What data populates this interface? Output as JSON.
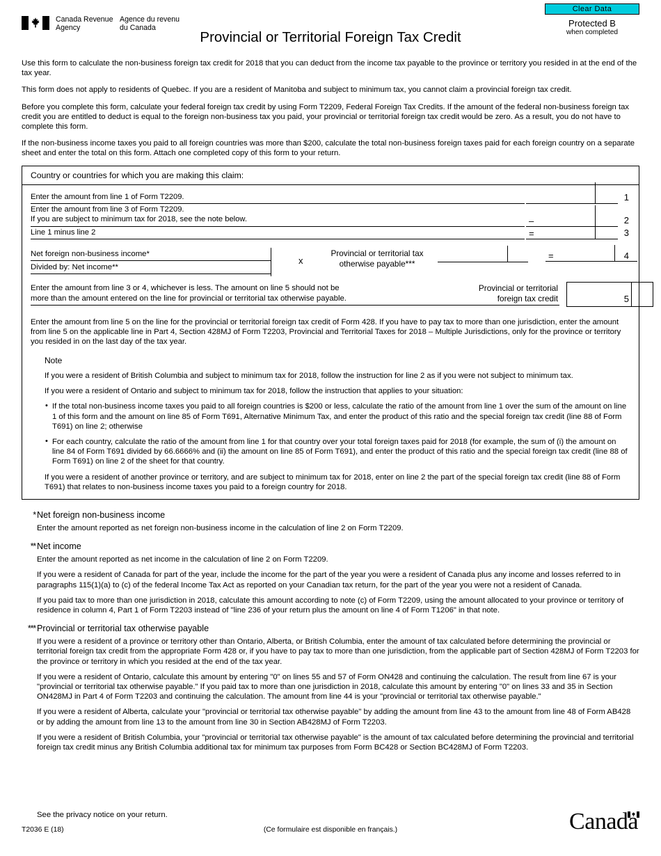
{
  "header": {
    "clear_data_label": "Clear Data",
    "protected_line1": "Protected B",
    "protected_line2": "when completed",
    "agency_en_line1": "Canada Revenue",
    "agency_en_line2": "Agency",
    "agency_fr_line1": "Agence du revenu",
    "agency_fr_line2": "du Canada",
    "title": "Provincial or Territorial Foreign Tax Credit",
    "flag_icon": "canada-flag-icon"
  },
  "intro": {
    "p1": "Use this form to calculate the non-business foreign tax credit for 2018 that you can deduct from the income tax payable to the province or territory you resided in at the end of the tax year.",
    "p2": "This form does not apply to residents of Quebec. If you are a resident of Manitoba and subject to minimum tax, you cannot claim a provincial foreign tax credit.",
    "p3": "Before you complete this form, calculate your federal foreign tax credit by using Form T2209, Federal Foreign Tax Credits. If the amount of the federal non-business foreign tax credit you are entitled to deduct is equal to the foreign non-business tax you paid, your provincial or territorial foreign tax credit would be zero. As a result, you do not have to complete this form.",
    "p4": "If the non-business income taxes you paid to all foreign countries was more than $200, calculate the total non-business foreign taxes paid for each foreign country on a separate sheet and enter the total on this form. Attach one completed copy of this form to your return."
  },
  "form": {
    "country_label": "Country or countries for which you are making this claim:",
    "country_value": "",
    "line1": {
      "label": "Enter the amount from line 1 of Form T2209.",
      "number": "1",
      "operator": "",
      "value": ""
    },
    "line2": {
      "label_a": "Enter the amount from line 3 of Form T2209.",
      "label_b_pre": "If you are subject to minimum tax for 2018, see the ",
      "label_b_link": "note",
      "label_b_post": " below.",
      "number": "2",
      "operator": "–",
      "value": ""
    },
    "line3": {
      "label": "Line 1 minus line 2",
      "number": "3",
      "operator": "=",
      "value": ""
    },
    "line4": {
      "numerator_label": "Net foreign non-business income",
      "numerator_mark": "*",
      "denominator_label": "Divided by: Net income",
      "denominator_mark": "**",
      "times_symbol": "x",
      "multiplier_label_line1": "Provincial or territorial tax",
      "multiplier_label_line2": "otherwise payable",
      "multiplier_mark": "***",
      "number": "4",
      "operator": "=",
      "numerator_value": "",
      "denominator_value": "",
      "multiplier_value": "",
      "value": ""
    },
    "line5": {
      "desc_line1": "Enter the amount from line 3 or 4, whichever is less. The amount on line 5 should not be",
      "desc_line2": "more than the amount entered on the line for provincial or territorial tax otherwise payable.",
      "credit_label_line1": "Provincial or territorial",
      "credit_label_line2": "foreign tax credit",
      "number": "5",
      "value": ""
    },
    "bottom_instruction": "Enter the amount from line 5 on the line for the provincial or territorial foreign tax credit of Form 428. If you have to pay tax to more than one jurisdiction, enter the amount from line 5 on the applicable line in Part 4, Section 428MJ of Form T2203, Provincial and Territorial Taxes for 2018 – Multiple Jurisdictions, only for the province or territory you resided in on the last day of the tax year.",
    "note": {
      "title": "Note",
      "p1": "If you were a resident of British Columbia and subject to minimum tax for 2018, follow the instruction for line 2 as if you were not subject to minimum tax.",
      "p2": "If you were a resident of Ontario and subject to minimum tax for 2018, follow the instruction that applies to your situation:",
      "bullet1": "If the total non-business income taxes you paid to all foreign countries is $200 or less, calculate the ratio of the amount from line 1 over the sum of the amount on line 1 of this form and the amount on line 85 of Form T691, Alternative Minimum Tax, and enter the product of this ratio and the special foreign tax credit (line 88 of Form T691) on line 2; otherwise",
      "bullet2": "For each country, calculate the ratio of the amount from line 1 for that country over your total foreign taxes paid for 2018 (for example, the sum of (i) the amount on line 84 of Form T691 divided by 66.6666% and (ii) the amount on line 85 of Form T691), and enter the product of this ratio and the special foreign tax credit (line 88 of Form T691) on line 2 of the sheet for that country.",
      "p3": "If you were a resident of another province or territory, and are subject to minimum tax for 2018, enter on line 2 the part of the special foreign tax credit (line 88 of Form T691) that relates to non-business income taxes you paid to a foreign country for 2018."
    }
  },
  "footnotes": [
    {
      "mark": "*",
      "title": "Net foreign non-business income",
      "paragraphs": [
        "Enter the amount reported as net foreign non-business income in the calculation of line 2 on Form T2209."
      ]
    },
    {
      "mark": "**",
      "title": "Net income",
      "paragraphs": [
        "Enter the amount reported as net income in the calculation of line 2 on Form T2209.",
        "If you were a resident of Canada for part of the year, include the income for the part of the year you were a resident of Canada plus any income and losses referred to in paragraphs 115(1)(a) to (c) of the federal Income Tax Act as reported on your Canadian tax return, for the part of the year you were not a resident of Canada.",
        "If you paid tax to more than one jurisdiction in 2018, calculate this amount according to note (c) of Form T2209, using the amount allocated to your province or territory of residence in column 4, Part 1 of Form T2203 instead of \"line 236 of your return plus the amount on line 4 of Form T1206\" in that note."
      ]
    },
    {
      "mark": "***",
      "title": "Provincial or territorial tax otherwise payable",
      "paragraphs": [
        "If you were a resident of a province or territory other than Ontario, Alberta, or British Columbia, enter the amount of tax calculated before determining the provincial or territorial foreign tax credit from the appropriate Form 428 or, if you have to pay tax to more than one jurisdiction, from the applicable part of Section 428MJ of Form T2203 for the province or territory in which you resided at the end of the tax year.",
        "If you were a resident of Ontario, calculate this amount by entering \"0\" on lines 55 and 57 of Form ON428 and continuing the calculation. The result from line 67 is your \"provincial or territorial tax otherwise payable.\" If you paid tax to more than one jurisdiction in 2018, calculate this amount by entering \"0\" on lines 33 and 35 in Section ON428MJ in Part 4 of Form T2203 and continuing the calculation. The amount from line 44 is your \"provincial or territorial tax otherwise payable.\"",
        "If you were a resident of Alberta, calculate your \"provincial or territorial tax otherwise payable\" by adding the amount from line 43 to the amount from line 48 of Form AB428 or by adding the amount from line 13 to the amount from line 30 in Section AB428MJ of Form T2203.",
        "If you were a resident of British Columbia, your \"provincial or territorial tax otherwise payable\" is the amount of tax calculated before determining the provincial and territorial foreign tax credit minus any British Columbia additional tax for minimum tax purposes from Form BC428 or Section BC428MJ of Form T2203."
      ]
    }
  ],
  "footer": {
    "privacy": "See the privacy notice on your return.",
    "form_code": "T2036 E (18)",
    "french_note": "(Ce formulaire est disponible en français.)",
    "wordmark": "Canada",
    "wordmark_flag_icon": "canada-flag-icon"
  },
  "colors": {
    "clear_data_bg": "#00CCDD",
    "link_blue": "#2222dd",
    "text": "#000000",
    "page_bg": "#ffffff"
  }
}
